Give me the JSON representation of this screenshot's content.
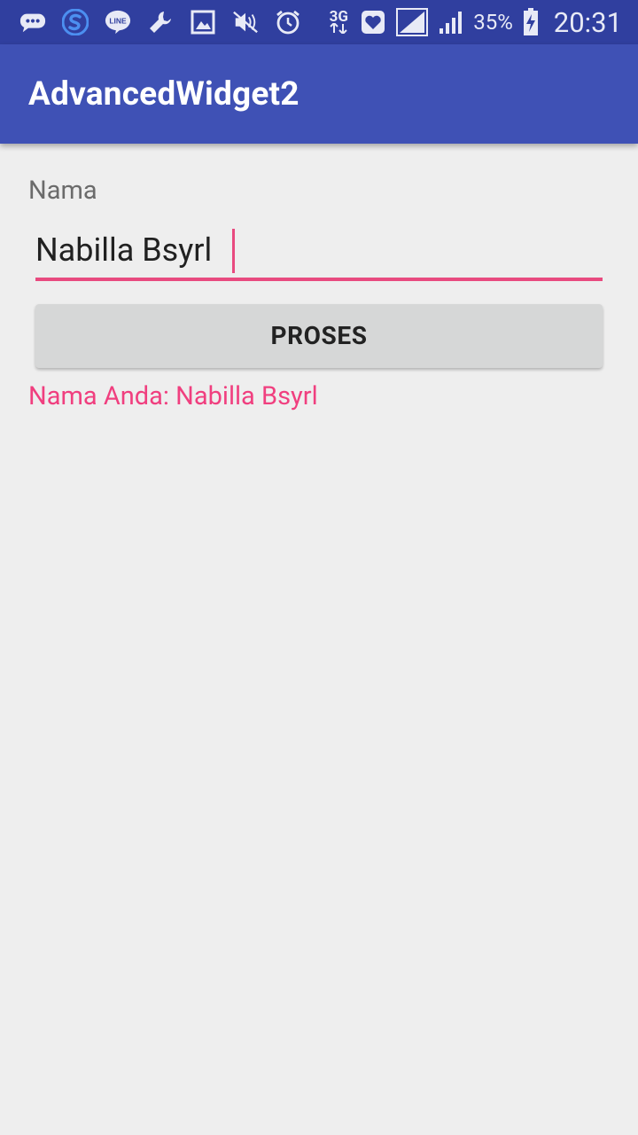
{
  "status_bar": {
    "icons": [
      "chat-bubble-icon",
      "s-app-icon",
      "line-icon",
      "wrench-icon",
      "gallery-icon",
      "mute-icon",
      "alarm-icon",
      "network-3g-icon",
      "heart-icon",
      "signal-icon",
      "signal-icon",
      "battery-charging-icon"
    ],
    "line_label": "LINE",
    "network_type": "3G",
    "battery_percent": "35%",
    "time": "20:31",
    "background": "#303f9f"
  },
  "app_bar": {
    "title": "AdvancedWidget2",
    "background": "#3f51b5"
  },
  "form": {
    "label": "Nama",
    "input_value": "Nabilla Bsyrl",
    "accent": "#e84a7f",
    "button_label": "PROSES"
  },
  "result": {
    "text": "Nama Anda: Nabilla Bsyrl",
    "color": "#f03f7f"
  }
}
